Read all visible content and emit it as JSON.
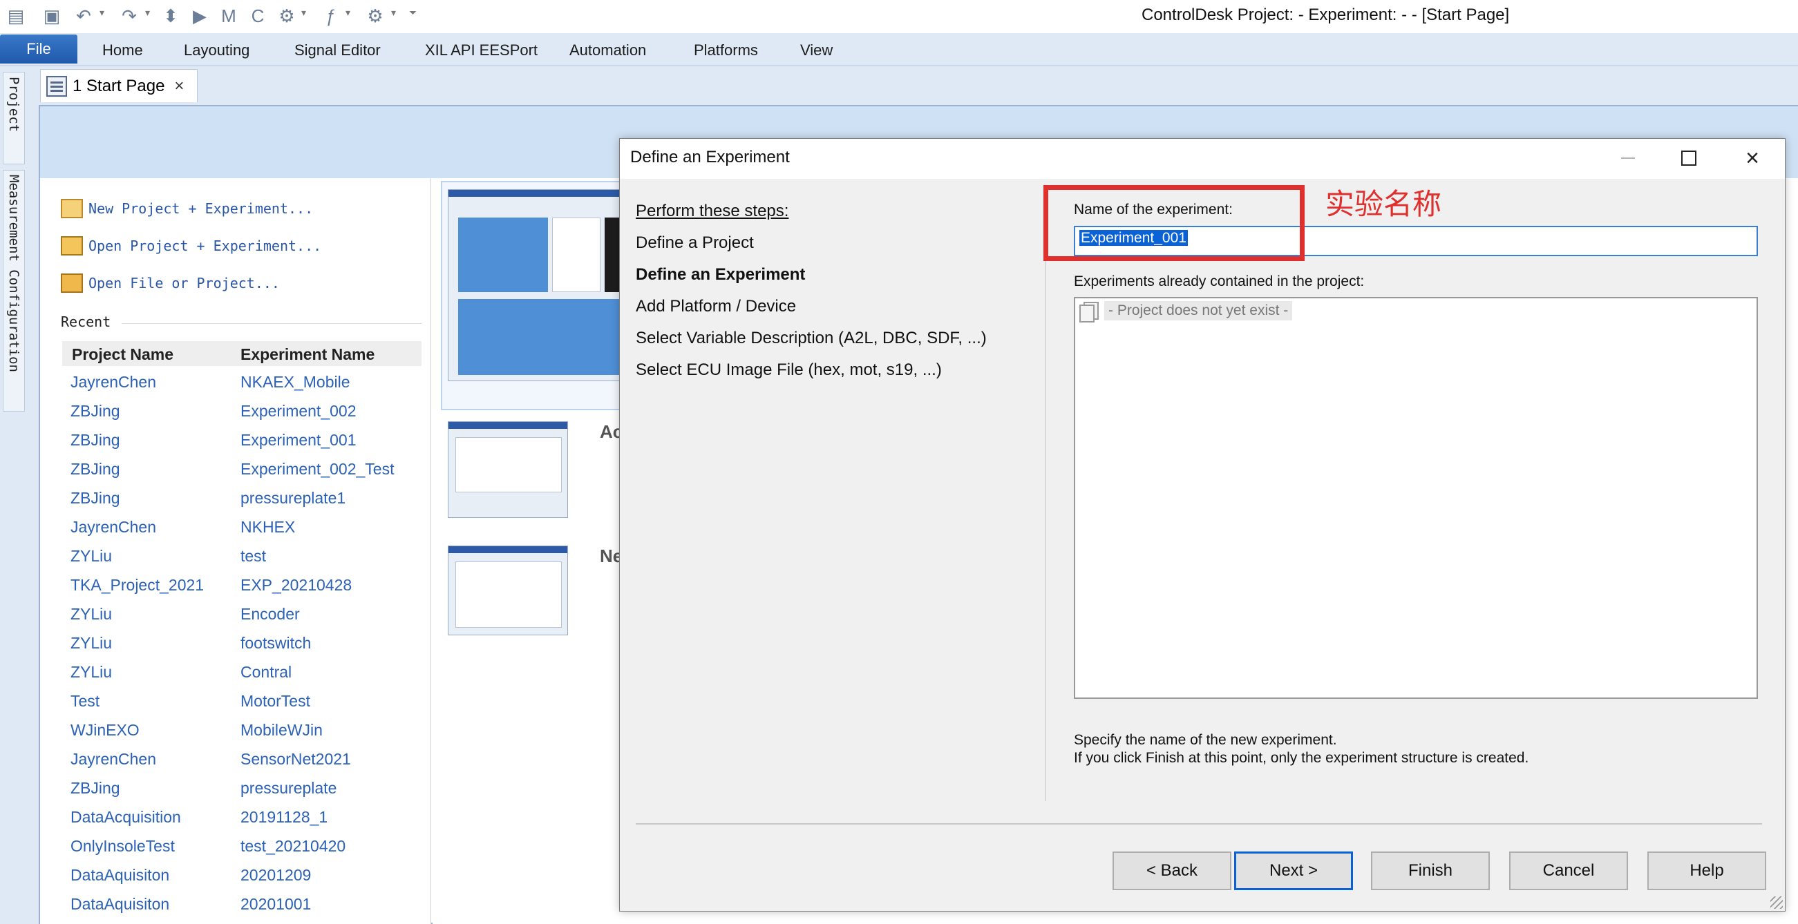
{
  "window": {
    "title": "ControlDesk  Project: -  Experiment: - - [Start Page]"
  },
  "ribbon": {
    "file_label": "File",
    "tabs": [
      "Home",
      "Layouting",
      "Signal Editor",
      "XIL API EESPort",
      "Automation",
      "Platforms",
      "View"
    ]
  },
  "document_tabs": [
    {
      "label": "1 Start Page",
      "close": "×"
    }
  ],
  "side_dock": {
    "tabs": [
      "Project",
      "Measurement Configuration"
    ]
  },
  "start_page": {
    "quick_links": [
      "New Project + Experiment...",
      "Open Project + Experiment...",
      "Open File or Project..."
    ],
    "recent_label": "Recent",
    "recent_headers": [
      "Project Name",
      "Experiment Name"
    ],
    "recent_rows": [
      [
        "JayrenChen",
        "NKAEX_Mobile"
      ],
      [
        "ZBJing",
        "Experiment_002"
      ],
      [
        "ZBJing",
        "Experiment_001"
      ],
      [
        "ZBJing",
        "Experiment_002_Test"
      ],
      [
        "ZBJing",
        "pressureplate1"
      ],
      [
        "JayrenChen",
        "NKHEX"
      ],
      [
        "ZYLiu",
        "test"
      ],
      [
        "TKA_Project_2021",
        "EXP_20210428"
      ],
      [
        "ZYLiu",
        "Encoder"
      ],
      [
        "ZYLiu",
        "footswitch"
      ],
      [
        "ZYLiu",
        "Contral"
      ],
      [
        "Test",
        "MotorTest"
      ],
      [
        "WJinEXO",
        "MobileWJin"
      ],
      [
        "JayrenChen",
        "SensorNet2021"
      ],
      [
        "ZBJing",
        "pressureplate"
      ],
      [
        "DataAcquisition",
        "20191128_1"
      ],
      [
        "OnlyInsoleTest",
        "test_20210420"
      ],
      [
        "DataAquisiton",
        "20201209"
      ],
      [
        "DataAquisiton",
        "20201001"
      ]
    ],
    "section_cut_1": "Ac",
    "section_cut_2": "Ne"
  },
  "dialog": {
    "title": "Define an Experiment",
    "steps_heading": "Perform these steps:",
    "steps": [
      "Define a Project",
      "Define an Experiment",
      "Add Platform / Device",
      "Select Variable Description (A2L, DBC, SDF, ...)",
      "Select ECU Image File (hex, mot, s19, ...)"
    ],
    "active_step_index": 1,
    "name_label": "Name of the experiment:",
    "name_value": "Experiment_001",
    "list_label": "Experiments already contained in the project:",
    "list_items": [
      "- Project does not yet exist -"
    ],
    "hint_line1": "Specify the name of the new experiment.",
    "hint_line2": "If you click Finish at this point, only the experiment structure is created.",
    "buttons": {
      "back": "< Back",
      "next": "Next >",
      "finish": "Finish",
      "cancel": "Cancel",
      "help": "Help"
    }
  },
  "annotation": {
    "text": "实验名称",
    "color": "#e0302e"
  },
  "colors": {
    "accent": "#0a63d6",
    "link": "#2b62b8",
    "ribbon_bg": "#dfe9f5",
    "file_tab": "#2a66b8"
  }
}
